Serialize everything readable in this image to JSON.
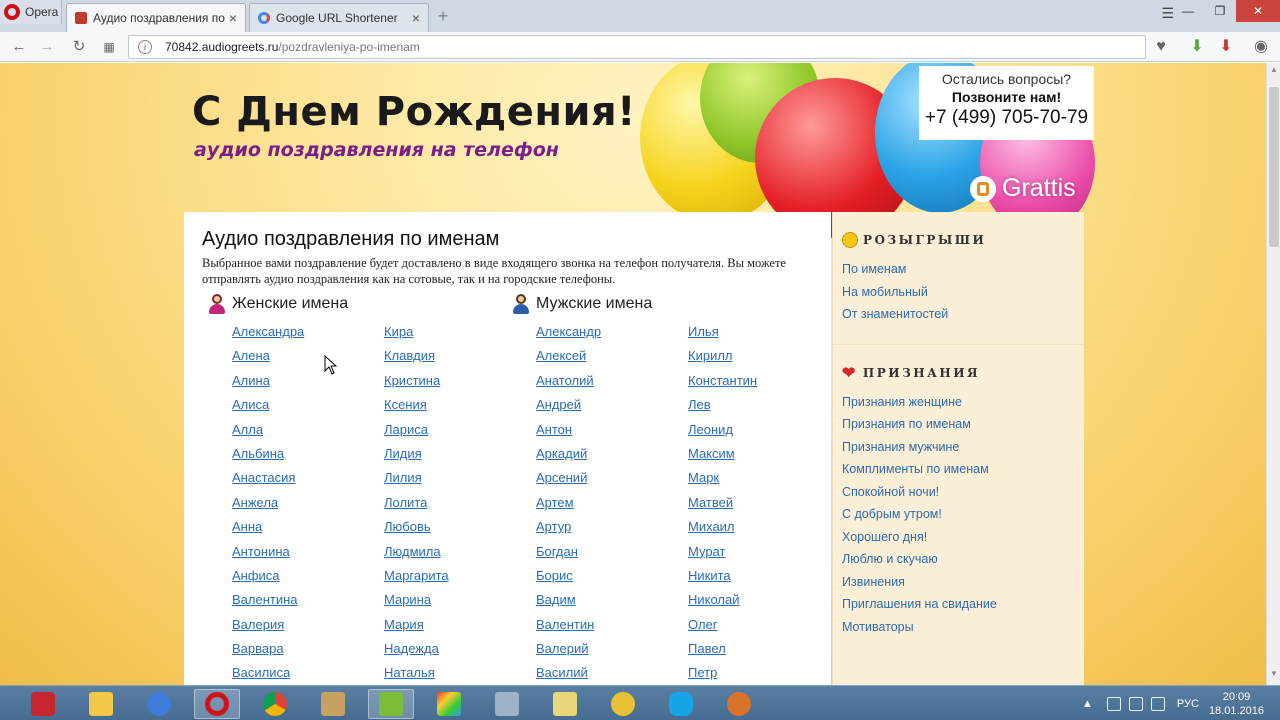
{
  "browser": {
    "menu_label": "Opera",
    "tabs": [
      {
        "label": "Аудио поздравления по"
      },
      {
        "label": "Google URL Shortener"
      }
    ],
    "url_host": "70842.audiogreets.ru",
    "url_path": "/pozdravleniya-po-imenam"
  },
  "hero": {
    "title": "С Днем Рождения!",
    "subtitle": "аудио поздравления на телефон",
    "contact_question": "Остались вопросы?",
    "contact_call": "Позвоните нам!",
    "contact_phone": "+7 (499) 705-70-79",
    "brand": "Grattis"
  },
  "content": {
    "title": "Аудио поздравления по именам",
    "description": "Выбранное вами поздравление будет доставлено в виде входящего звонка на телефон получателя. Вы можете отправлять аудио поздравления как на сотовые, так и на городские телефоны.",
    "female_heading": "Женские имена",
    "male_heading": "Мужские имена",
    "female_col1": [
      "Александра",
      "Алена",
      "Алина",
      "Алиса",
      "Алла",
      "Альбина",
      "Анастасия",
      "Анжела",
      "Анна",
      "Антонина",
      "Анфиса",
      "Валентина",
      "Валерия",
      "Варвара",
      "Василиса"
    ],
    "female_col2": [
      "Кира",
      "Клавдия",
      "Кристина",
      "Ксения",
      "Лариса",
      "Лидия",
      "Лилия",
      "Лолита",
      "Любовь",
      "Людмила",
      "Маргарита",
      "Марина",
      "Мария",
      "Надежда",
      "Наталья"
    ],
    "male_col1": [
      "Александр",
      "Алексей",
      "Анатолий",
      "Андрей",
      "Антон",
      "Аркадий",
      "Арсений",
      "Артем",
      "Артур",
      "Богдан",
      "Борис",
      "Вадим",
      "Валентин",
      "Валерий",
      "Василий"
    ],
    "male_col2": [
      "Илья",
      "Кирилл",
      "Константин",
      "Лев",
      "Леонид",
      "Максим",
      "Марк",
      "Матвей",
      "Михаил",
      "Мурат",
      "Никита",
      "Николай",
      "Олег",
      "Павел",
      "Петр"
    ]
  },
  "sidebar": {
    "section1_title": "РОЗЫГРЫШИ",
    "section1_links": [
      "По именам",
      "На мобильный",
      "От знаменитостей"
    ],
    "section2_title": "ПРИЗНАНИЯ",
    "section2_links": [
      "Признания женщине",
      "Признания по именам",
      "Признания мужчине",
      "Комплименты по именам",
      "Спокойной ночи!",
      "С добрым утром!",
      "Хорошего дня!",
      "Люблю и скучаю",
      "Извинения",
      "Приглашения на свидание",
      "Мотиваторы"
    ]
  },
  "taskbar": {
    "lang": "РУС",
    "time": "20:09",
    "date": "18.01.2016"
  },
  "colors": {
    "link": "#2b6cb0",
    "subtitle": "#7a1f8a",
    "accent_red": "#cc0f16"
  }
}
